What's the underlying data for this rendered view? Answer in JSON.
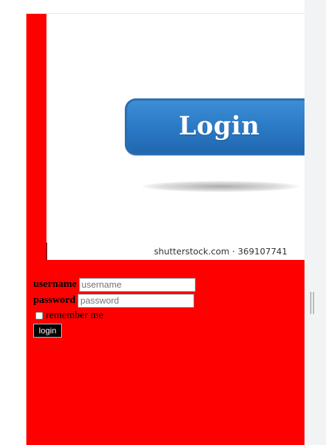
{
  "hero": {
    "button_text": "Login",
    "watermark": "shutterstock.com · 369107741"
  },
  "form": {
    "username_label": "username",
    "username_placeholder": "username",
    "password_label": "password",
    "password_placeholder": "password",
    "remember_label": "remember me",
    "remember_checked": false,
    "submit_label": "login"
  },
  "colors": {
    "page_background": "#ff0000",
    "button_background": "#000000",
    "hero_button_blue": "#2a78c4"
  },
  "icons": {
    "scrollbar": "scroll-grip-icon"
  }
}
